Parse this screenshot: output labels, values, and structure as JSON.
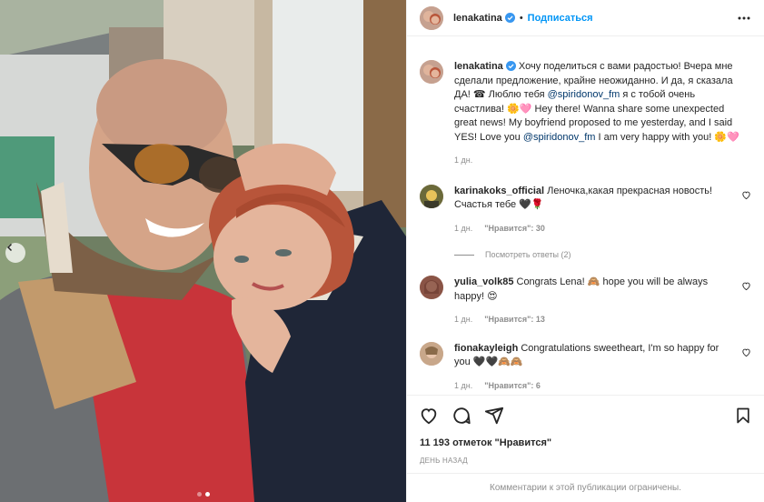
{
  "post": {
    "author": "lenakatina",
    "follow_label": "Подписаться",
    "separator": "•",
    "caption": {
      "author": "lenakatina",
      "text_ru_1": "Хочу поделиться с вами радостью! Вчера мне сделали предложение, крайне неожиданно. И да, я сказала ДА! ☎ Люблю тебя ",
      "mention": "@spiridonov_fm",
      "text_ru_2": " я с тобой очень счастлива! 🌼🩷",
      "text_en_1": " Hey there! Wanna share some unexpected great news! My boyfriend proposed to me yesterday, and I said YES! Love you ",
      "text_en_2": " I am very happy with you! 🌼🩷",
      "time": "1 дн."
    },
    "comments": [
      {
        "user": "karinakoks_official",
        "text": "Леночка,какая прекрасная новость! Счастья тебе 🖤🌹",
        "time": "1 дн.",
        "likes": "\"Нравится\": 30",
        "replies": "Посмотреть ответы (2)"
      },
      {
        "user": "yulia_volk85",
        "text": "Congrats Lena! 🙈 hope you will be always happy! 😍",
        "time": "1 дн.",
        "likes": "\"Нравится\": 13"
      },
      {
        "user": "fionakayleigh",
        "text": "Congratulations sweetheart, I'm so happy for you 🖤🖤🙈🙈",
        "time": "1 дн.",
        "likes": "\"Нравится\": 6"
      }
    ],
    "likes_text": "11 193 отметок \"Нравится\"",
    "date_text": "ДЕНЬ НАЗАД",
    "comments_limited": "Комментарии к этой публикации ограничены.",
    "carousel": {
      "slides": 2,
      "active": 2
    }
  },
  "icons": [
    "verified-badge",
    "more-icon",
    "heart-icon",
    "comment-icon",
    "share-icon",
    "save-icon",
    "chevron-left-icon"
  ],
  "colors": {
    "accent": "#0095f6",
    "mention": "#00376b",
    "muted": "#8e8e8e",
    "border": "#efefef"
  }
}
